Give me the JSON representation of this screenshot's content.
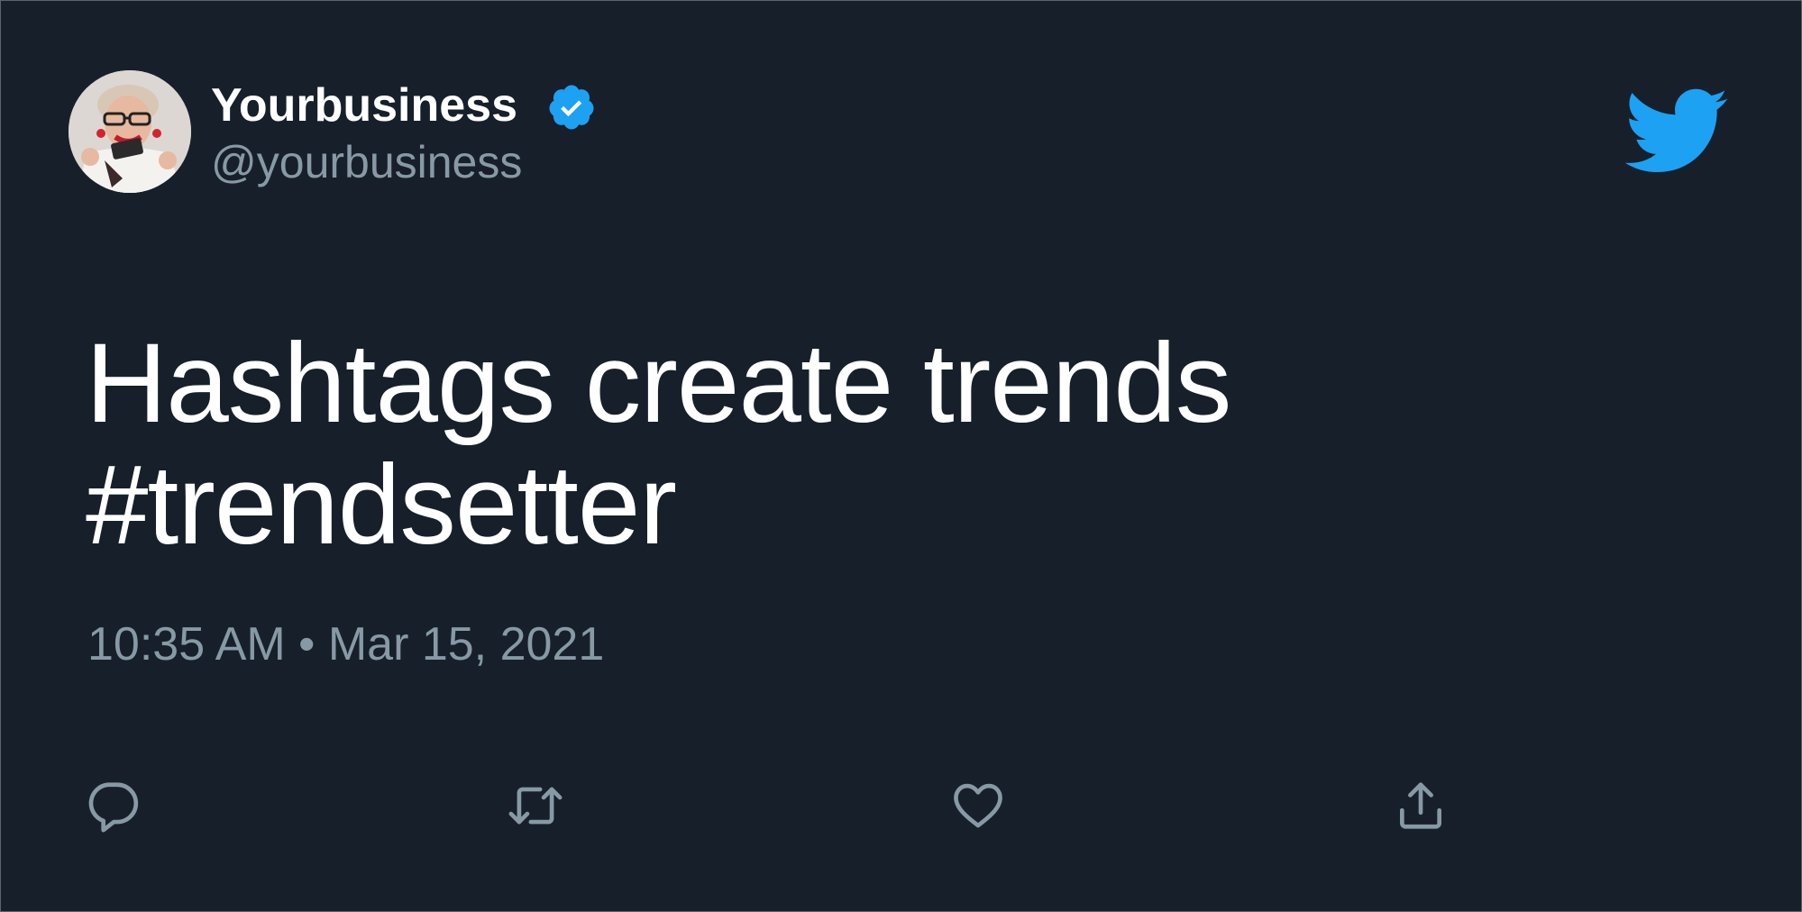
{
  "account": {
    "display_name": "Yourbusiness",
    "handle": "@yourbusiness",
    "verified": true,
    "verified_icon": "verified-badge-icon"
  },
  "tweet": {
    "lines": [
      "Hashtags create trends",
      "#trendsetter"
    ],
    "time": "10:35 AM",
    "separator": "•",
    "date": "Mar 15, 2021"
  },
  "actions": {
    "reply_icon": "reply-icon",
    "retweet_icon": "retweet-icon",
    "like_icon": "heart-icon",
    "share_icon": "share-icon"
  },
  "brand": {
    "logo_icon": "twitter-bird-icon",
    "accent_color": "#1da1f2",
    "background_color": "#17202a",
    "muted_text_color": "#8899a6"
  }
}
